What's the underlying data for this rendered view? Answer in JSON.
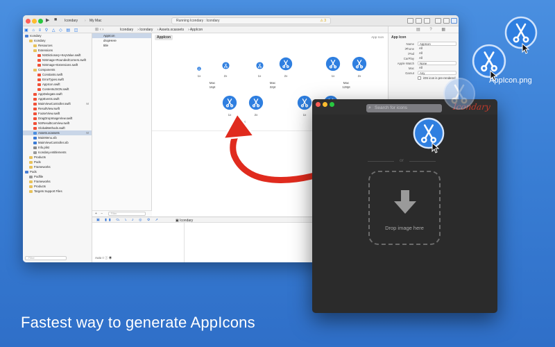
{
  "caption": "Fastest way to generate AppIcons",
  "colors": {
    "background": "#3a7fd5",
    "icon_blue": "#2f7fe0",
    "arrow_red": "#e02b1e",
    "brand_red": "#c0392b",
    "dark_window": "#2b2b2b"
  },
  "xcode": {
    "scheme": "Icondary",
    "destination": "My Mac",
    "status": "Running Icondary : Icondary",
    "warnings": "3",
    "breadcrumbs": [
      "Icondary",
      "Icondary",
      "Assets.xcassets",
      "AppIcon"
    ],
    "navigator": [
      {
        "label": "Icondary",
        "depth": 0,
        "kind": "project"
      },
      {
        "label": "Icondary",
        "depth": 1,
        "kind": "folder"
      },
      {
        "label": "Resources",
        "depth": 2,
        "kind": "folder"
      },
      {
        "label": "Extensions",
        "depth": 2,
        "kind": "folder"
      },
      {
        "label": "NSDictionary+KeyValue.swift",
        "depth": 3,
        "kind": "swift"
      },
      {
        "label": "NSImage+RoundedCorners.swift",
        "depth": 3,
        "kind": "swift"
      },
      {
        "label": "NSImage+Extensions.swift",
        "depth": 3,
        "kind": "swift"
      },
      {
        "label": "Components",
        "depth": 2,
        "kind": "folder"
      },
      {
        "label": "Constants.swift",
        "depth": 3,
        "kind": "swift"
      },
      {
        "label": "ErrorTypes.swift",
        "depth": 3,
        "kind": "swift"
      },
      {
        "label": "AppIcon.swift",
        "depth": 3,
        "kind": "swift"
      },
      {
        "label": "ContentsJSON.swift",
        "depth": 3,
        "kind": "swift"
      },
      {
        "label": "AppDelegate.swift",
        "depth": 2,
        "kind": "swift"
      },
      {
        "label": "AppEvents.swift",
        "depth": 2,
        "kind": "swift"
      },
      {
        "label": "MainViewController.swift",
        "depth": 2,
        "kind": "swift",
        "badge": "M"
      },
      {
        "label": "ResultView.swift",
        "depth": 2,
        "kind": "swift"
      },
      {
        "label": "FooterView.swift",
        "depth": 2,
        "kind": "swift"
      },
      {
        "label": "DragDropImageView.swift",
        "depth": 2,
        "kind": "swift"
      },
      {
        "label": "NSResultIconView.swift",
        "depth": 2,
        "kind": "swift"
      },
      {
        "label": "GlobalMethods.swift",
        "depth": 2,
        "kind": "swift"
      },
      {
        "label": "Assets.xcassets",
        "depth": 2,
        "kind": "assets",
        "selected": true,
        "badge": "M"
      },
      {
        "label": "MainMenu.xib",
        "depth": 2,
        "kind": "xib"
      },
      {
        "label": "MainViewController.xib",
        "depth": 2,
        "kind": "xib"
      },
      {
        "label": "Info.plist",
        "depth": 2,
        "kind": "plist"
      },
      {
        "label": "Icondary.entitlements",
        "depth": 2,
        "kind": "file"
      },
      {
        "label": "Products",
        "depth": 1,
        "kind": "folder"
      },
      {
        "label": "Pods",
        "depth": 1,
        "kind": "folder"
      },
      {
        "label": "Frameworks",
        "depth": 1,
        "kind": "folder"
      },
      {
        "label": "Pods",
        "depth": 0,
        "kind": "project"
      },
      {
        "label": "Podfile",
        "depth": 1,
        "kind": "file"
      },
      {
        "label": "Frameworks",
        "depth": 1,
        "kind": "folder"
      },
      {
        "label": "Products",
        "depth": 1,
        "kind": "folder"
      },
      {
        "label": "Targets Support Files",
        "depth": 1,
        "kind": "folder"
      }
    ],
    "navigator_filter": "Filter",
    "asset_list": [
      {
        "label": "AppIcon",
        "selected": true
      },
      {
        "label": "dropHere",
        "selected": false
      },
      {
        "label": "title",
        "selected": false
      }
    ],
    "asset_filter": "Filter",
    "canvas": {
      "set_name": "AppIcon",
      "kind_label": "App Icon",
      "scales": [
        "1x",
        "2x"
      ],
      "groups": [
        {
          "label": "Mac",
          "size": "16pt"
        },
        {
          "label": "Mac",
          "size": "32pt"
        },
        {
          "label": "Mac",
          "size": "128pt"
        },
        {
          "label": "Mac",
          "size": "256pt"
        },
        {
          "label": "Mac",
          "size": "512pt"
        }
      ]
    },
    "inspector": {
      "title": "App Icon",
      "rows": [
        {
          "key": "Name",
          "value": "AppIcon",
          "style": "box"
        },
        {
          "key": "iPhone",
          "value": "All",
          "style": "plain"
        },
        {
          "key": "iPad",
          "value": "All",
          "style": "plain"
        },
        {
          "key": "CarPlay",
          "value": "All",
          "style": "plain"
        },
        {
          "key": "Apple Watch",
          "value": "None",
          "style": "pop"
        },
        {
          "key": "Mac",
          "value": "All",
          "style": "plain"
        },
        {
          "key": "Gamut",
          "value": "Any",
          "style": "pop"
        }
      ],
      "checkbox": "iOS icon is pre-rendered"
    },
    "debug": {
      "process": "Icondary",
      "auto_label": "Auto"
    }
  },
  "iconary": {
    "brand": "Icondary",
    "search_placeholder": "Search for icons",
    "or": "or",
    "drop_label": "Drop image here"
  },
  "drag_file": {
    "filename": "AppIcon.png"
  }
}
